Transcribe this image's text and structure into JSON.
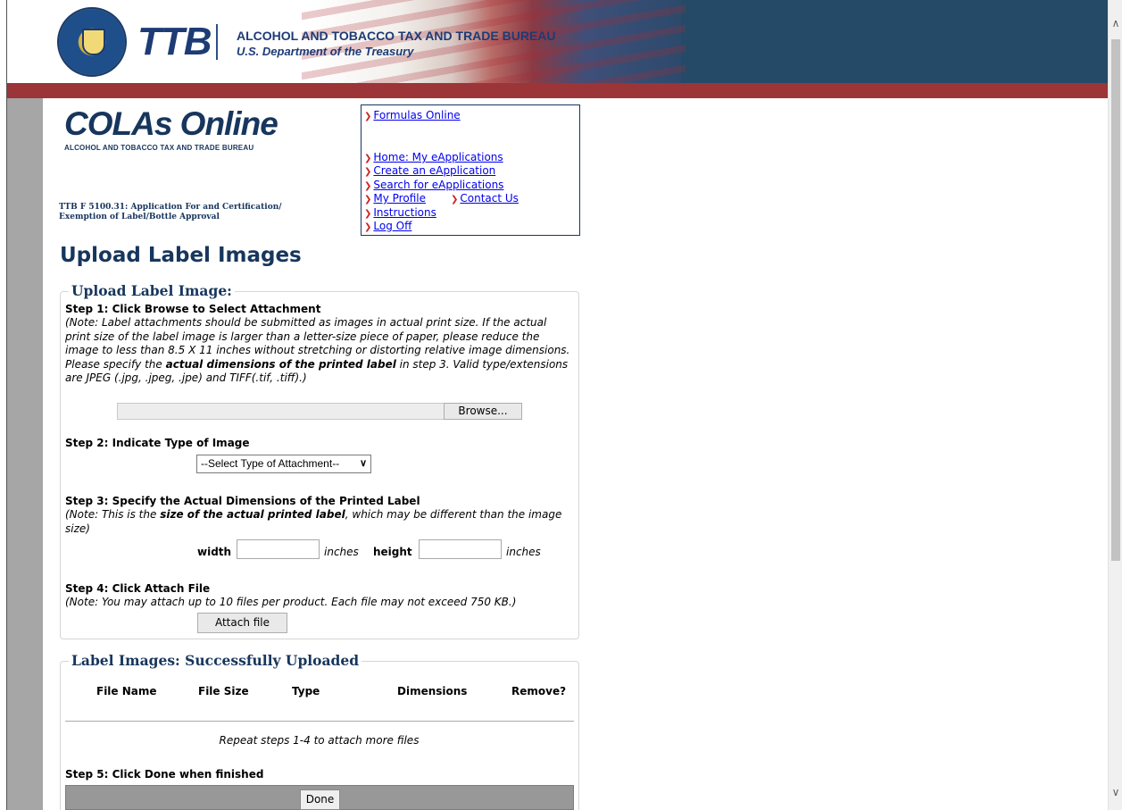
{
  "header": {
    "logo_text": "TTB",
    "bureau_name": "ALCOHOL AND TOBACCO TAX AND TRADE BUREAU",
    "department": "U.S. Department of the Treasury",
    "banner_color": "#244a68",
    "stripe_color": "#9b3538"
  },
  "app": {
    "logo_title": "COLAs Online",
    "logo_subtitle": "ALCOHOL AND TOBACCO TAX AND TRADE BUREAU",
    "form_title_line1": "TTB F 5100.31: Application For and Certification/",
    "form_title_line2": "Exemption of Label/Bottle Approval"
  },
  "nav": {
    "formulas_online": "Formulas Online",
    "home": "Home: My eApplications",
    "create": "Create an eApplication",
    "search": "Search for eApplications",
    "profile": "My Profile",
    "contact": "Contact Us",
    "instructions": "Instructions",
    "logoff": "Log Off",
    "arrow_glyph": "❯",
    "link_color": "#0000ee",
    "arrow_color": "#cc2222"
  },
  "page": {
    "heading": "Upload Label Images"
  },
  "upload": {
    "legend": "Upload Label Image:",
    "step1_title": "Step 1: Click Browse to Select Attachment",
    "step1_note_a": "(Note: Label attachments should be submitted as images in actual print size. If the actual print size of the label image is larger than a letter-size piece of paper, please reduce the image to less than 8.5 X 11 inches without stretching or distorting relative image dimensions. Please specify the ",
    "step1_note_bold": "actual dimensions of the printed label",
    "step1_note_b": " in step 3. Valid type/extensions are JPEG (.jpg, .jpeg, .jpe) and TIFF(.tif, .tiff).)",
    "browse_label": "Browse...",
    "file_value": "",
    "step2_title": "Step 2: Indicate Type of Image",
    "type_select_value": "--Select Type of Attachment--",
    "step3_title": "Step 3: Specify the Actual Dimensions of the Printed Label",
    "step3_note_a": "(Note: This is the ",
    "step3_note_bold": "size of the actual printed label",
    "step3_note_b": ", which may be different than the image size)",
    "width_label": "width",
    "height_label": "height",
    "unit_label": "inches",
    "width_value": "",
    "height_value": "",
    "step4_title": "Step 4: Click Attach File",
    "step4_note": "(Note: You may attach up to 10 files per product. Each file may not exceed 750 KB.)",
    "attach_label": "Attach file"
  },
  "uploaded": {
    "legend": "Label Images: Successfully Uploaded",
    "columns": [
      "File Name",
      "File Size",
      "Type",
      "Dimensions",
      "Remove?"
    ],
    "rows": [],
    "repeat_note": "Repeat steps 1-4 to attach more files",
    "step5_title": "Step 5: Click Done when finished",
    "done_label": "Done"
  }
}
